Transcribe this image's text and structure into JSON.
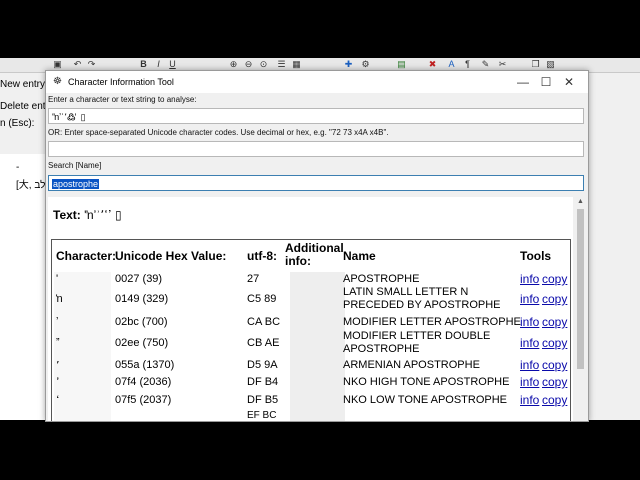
{
  "background": {
    "toolbar_icons": [
      "save-icon",
      "undo-icon",
      "redo-icon",
      "bold-icon",
      "italic-icon",
      "underline-icon",
      "zoom-in-icon",
      "zoom-out-icon",
      "zoom-reset-icon",
      "list-icon",
      "grid-icon",
      "add-icon",
      "gear-icon",
      "chart-icon",
      "delete-icon",
      "text-icon",
      "pilcrow-icon",
      "tools-icon",
      "scissors-icon",
      "copy-icon",
      "paste-icon"
    ],
    "left_items": {
      "new_entry": "New entry (I",
      "delete_entry": "Delete entr",
      "esc_label": "n (Esc):",
      "dash": "-",
      "hebrew_entry": "[大, לב"
    }
  },
  "dialog": {
    "title": "Character Information Tool",
    "minimize": "—",
    "maximize": "☐",
    "close": "✕",
    "enter_label": "Enter a character or text string to analyse:",
    "text_input_value": "'ŉʼʾ՚߷ ̓ ▯",
    "codes_label": "OR: Enter space-separated Unicode character codes. Use decimal or hex, e.g. \"72 73 x4A x4B\".",
    "codes_input_value": "",
    "search_label": "Search [Name]",
    "search_value": "apostrophe",
    "text_prefix": "Text:",
    "text_value": "'ŉʼʾ՚ߴߵ ▯",
    "headers": {
      "character": "Character:",
      "unicode": "Unicode Hex Value:",
      "utf8": "utf-8:",
      "additional": "Additional info:",
      "name": "Name",
      "tools": "Tools"
    },
    "rows": [
      {
        "char": "'",
        "hex": "0027 (39)",
        "utf8": "27",
        "name": "APOSTROPHE",
        "info": "info",
        "copy": "copy"
      },
      {
        "char": "ŉ",
        "hex": "0149 (329)",
        "utf8": "C5 89",
        "name": "LATIN SMALL LETTER N PRECEDED BY APOSTROPHE",
        "info": "info",
        "copy": "copy"
      },
      {
        "char": "ʼ",
        "hex": "02bc (700)",
        "utf8": "CA BC",
        "name": "MODIFIER LETTER APOSTROPHE",
        "info": "info",
        "copy": "copy"
      },
      {
        "char": "ˮ",
        "hex": "02ee (750)",
        "utf8": "CB AE",
        "name": "MODIFIER LETTER DOUBLE APOSTROPHE",
        "info": "info",
        "copy": "copy"
      },
      {
        "char": "՚",
        "hex": "055a (1370)",
        "utf8": "D5 9A",
        "name": "ARMENIAN APOSTROPHE",
        "info": "info",
        "copy": "copy"
      },
      {
        "char": "ߴ",
        "hex": "07f4 (2036)",
        "utf8": "DF B4",
        "name": "NKO HIGH TONE APOSTROPHE",
        "info": "info",
        "copy": "copy"
      },
      {
        "char": "ߵ",
        "hex": "07f5 (2037)",
        "utf8": "DF B5",
        "name": "NKO LOW TONE APOSTROPHE",
        "info": "info",
        "copy": "copy"
      }
    ],
    "partial_utf8": "EF BC"
  }
}
